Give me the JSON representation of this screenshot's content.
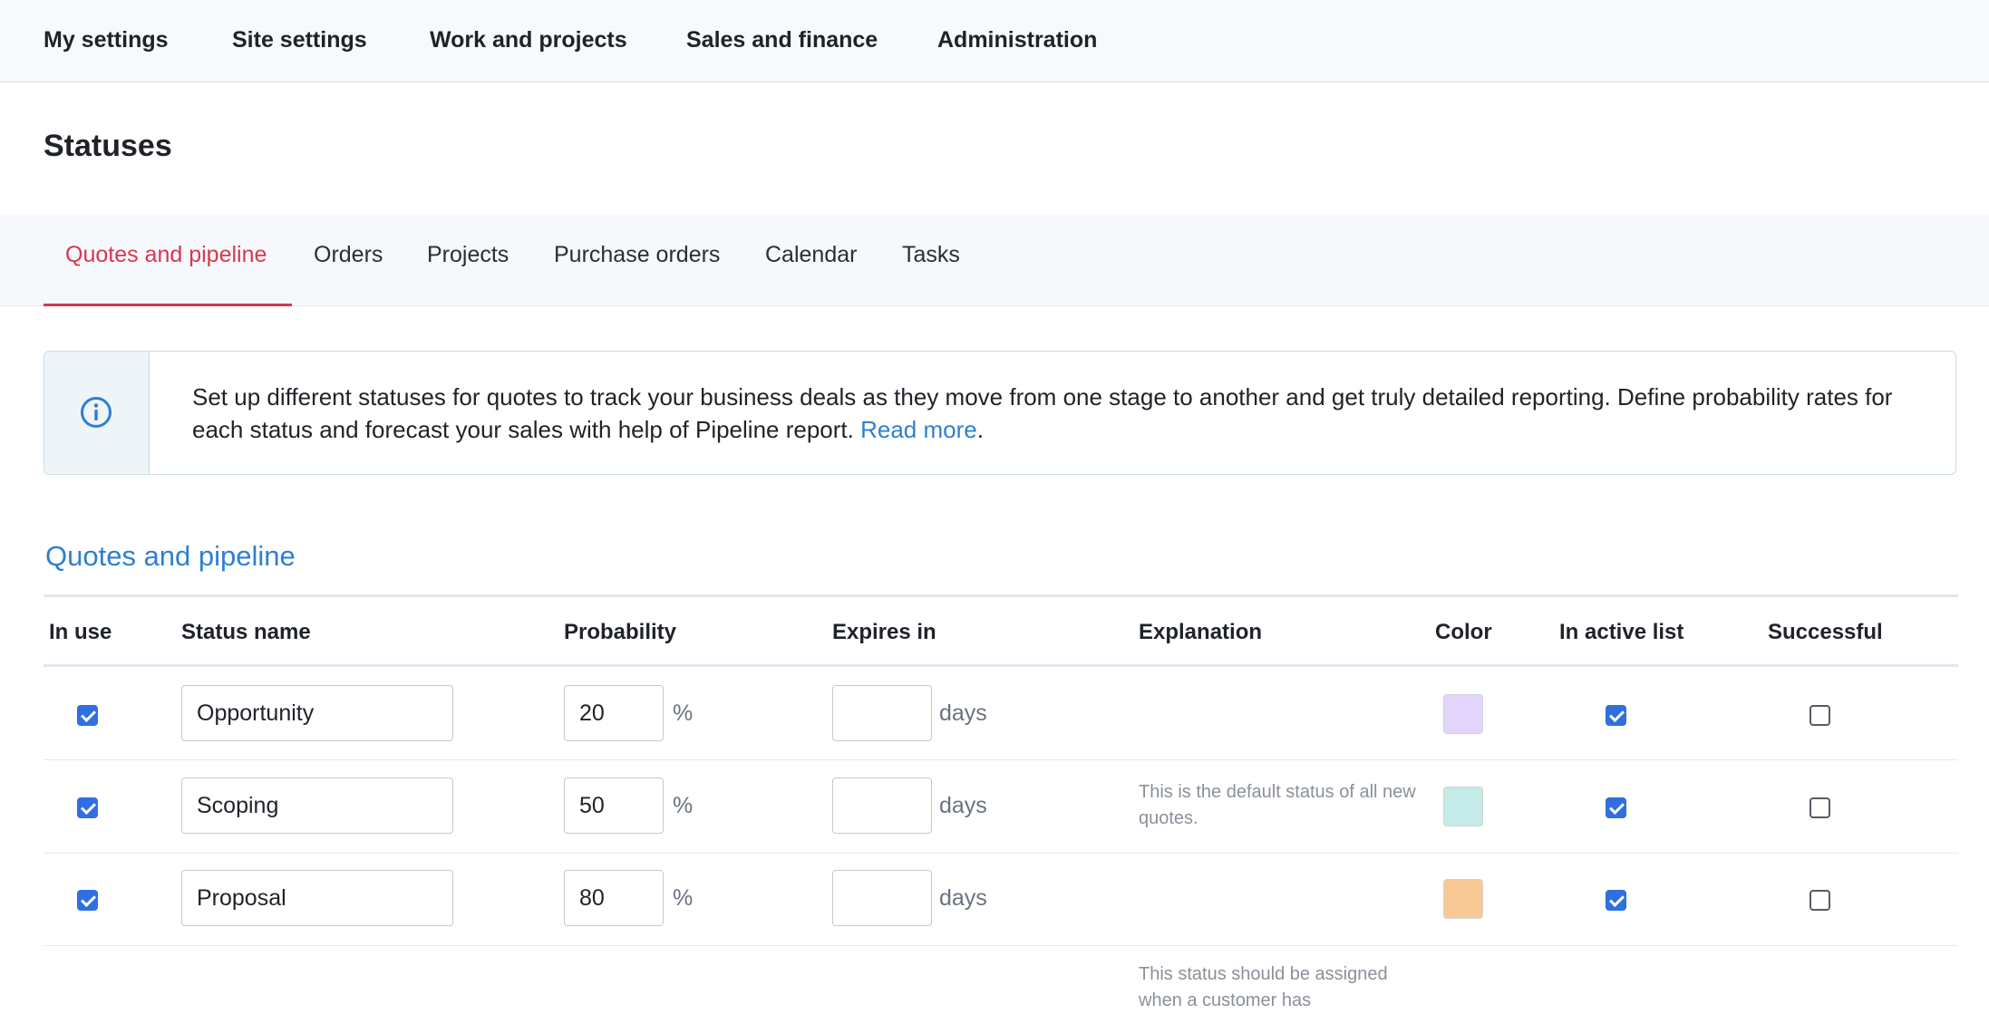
{
  "top_nav": [
    "My settings",
    "Site settings",
    "Work and projects",
    "Sales and finance",
    "Administration"
  ],
  "page_title": "Statuses",
  "tabs": [
    {
      "label": "Quotes and pipeline",
      "active": true
    },
    {
      "label": "Orders",
      "active": false
    },
    {
      "label": "Projects",
      "active": false
    },
    {
      "label": "Purchase orders",
      "active": false
    },
    {
      "label": "Calendar",
      "active": false
    },
    {
      "label": "Tasks",
      "active": false
    }
  ],
  "info": {
    "icon": "info-circle-icon",
    "text": "Set up different statuses for quotes to track your business deals as they move from one stage to another and get truly detailed reporting. Define probability rates for each status and forecast your sales with help of Pipeline report.",
    "link": "Read more",
    "trailing": "."
  },
  "section_title": "Quotes and pipeline",
  "columns": [
    "In use",
    "Status name",
    "Probability",
    "Expires in",
    "Explanation",
    "Color",
    "In active list",
    "Successful"
  ],
  "units": {
    "percent": "%",
    "days": "days"
  },
  "rows": [
    {
      "in_use": true,
      "name": "Opportunity",
      "probability": "20",
      "expires": "",
      "explanation": "",
      "color": "#e2d4fb",
      "active_list": true,
      "successful": false
    },
    {
      "in_use": true,
      "name": "Scoping",
      "probability": "50",
      "expires": "",
      "explanation": "This is the default status of all new quotes.",
      "color": "#c4ebe8",
      "active_list": true,
      "successful": false
    },
    {
      "in_use": true,
      "name": "Proposal",
      "probability": "80",
      "expires": "",
      "explanation": "",
      "color": "#f8c995",
      "active_list": true,
      "successful": false
    }
  ],
  "partial_explanation": "This status should be assigned when a customer has",
  "colors": {
    "accent_red": "#d6384f",
    "link_blue": "#2f7fd1",
    "checkbox_blue": "#2f6fe0"
  }
}
